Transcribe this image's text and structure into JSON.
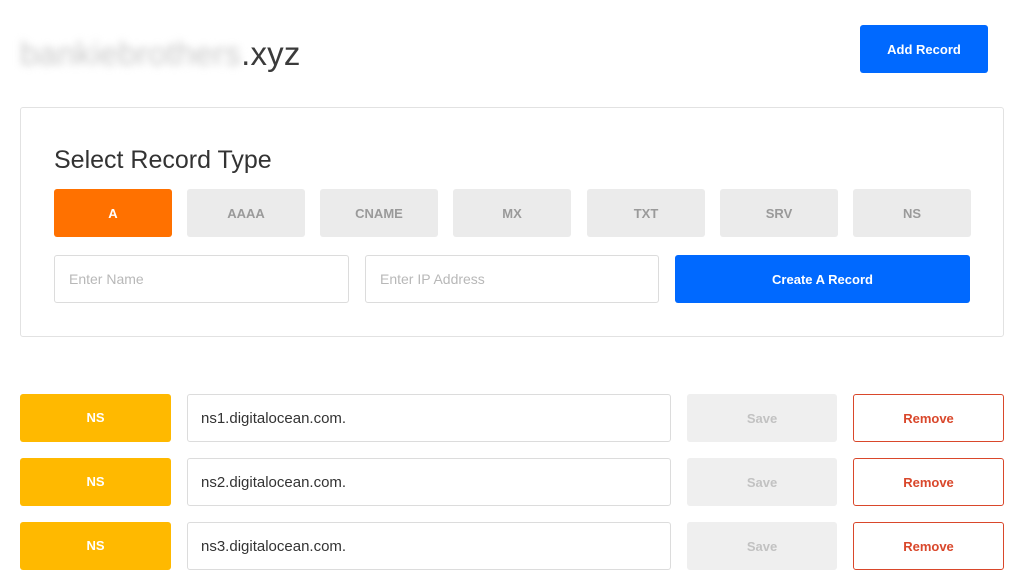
{
  "header": {
    "domain_name_obscured": "bankiebrothers",
    "domain_tld": ".xyz",
    "add_record_label": "Add Record"
  },
  "create_panel": {
    "title": "Select Record Type",
    "record_types": [
      {
        "label": "A",
        "active": true
      },
      {
        "label": "AAAA",
        "active": false
      },
      {
        "label": "CNAME",
        "active": false
      },
      {
        "label": "MX",
        "active": false
      },
      {
        "label": "TXT",
        "active": false
      },
      {
        "label": "SRV",
        "active": false
      },
      {
        "label": "NS",
        "active": false
      }
    ],
    "name_input": {
      "placeholder": "Enter Name",
      "value": ""
    },
    "ip_input": {
      "placeholder": "Enter IP Address",
      "value": ""
    },
    "create_button_label": "Create A Record"
  },
  "records": [
    {
      "type": "NS",
      "value": "ns1.digitalocean.com.",
      "save_label": "Save",
      "remove_label": "Remove"
    },
    {
      "type": "NS",
      "value": "ns2.digitalocean.com.",
      "save_label": "Save",
      "remove_label": "Remove"
    },
    {
      "type": "NS",
      "value": "ns3.digitalocean.com.",
      "save_label": "Save",
      "remove_label": "Remove"
    }
  ],
  "colors": {
    "primary_blue": "#0069ff",
    "active_type_orange": "#ff7100",
    "ns_badge_yellow": "#ffb900",
    "remove_red": "#d9472b"
  }
}
